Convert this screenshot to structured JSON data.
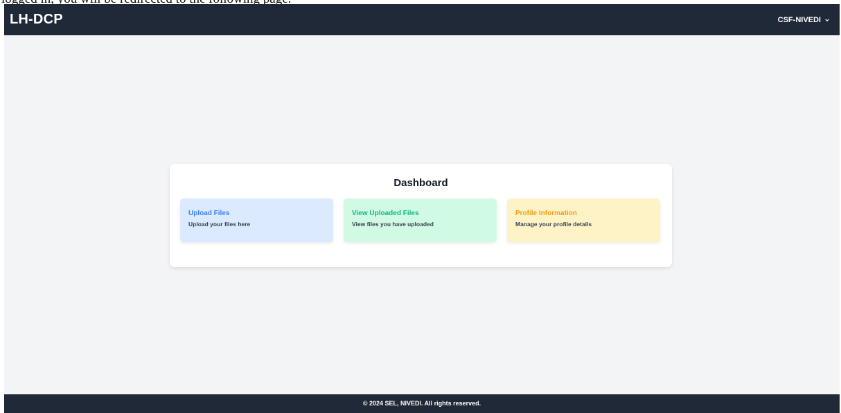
{
  "caption": "logged in, you will be redirected to the following page.",
  "header": {
    "brand": "LH-DCP",
    "user": "CSF-NIVEDI",
    "user_menu_icon": "chevron-down-icon"
  },
  "dashboard": {
    "title": "Dashboard",
    "tiles": [
      {
        "title": "Upload Files",
        "description": "Upload your files here",
        "color": "#3b82f6",
        "background": "#dbeafe"
      },
      {
        "title": "View Uploaded Files",
        "description": "View files you have uploaded",
        "color": "#10b981",
        "background": "#d1fae5"
      },
      {
        "title": "Profile Information",
        "description": "Manage your profile details",
        "color": "#f59e0b",
        "background": "#fef3c7"
      }
    ]
  },
  "footer": {
    "text": "© 2024 SEL, NIVEDI. All rights reserved."
  },
  "colors": {
    "navbar": "#1f2937",
    "page_background": "#f3f4f6"
  }
}
